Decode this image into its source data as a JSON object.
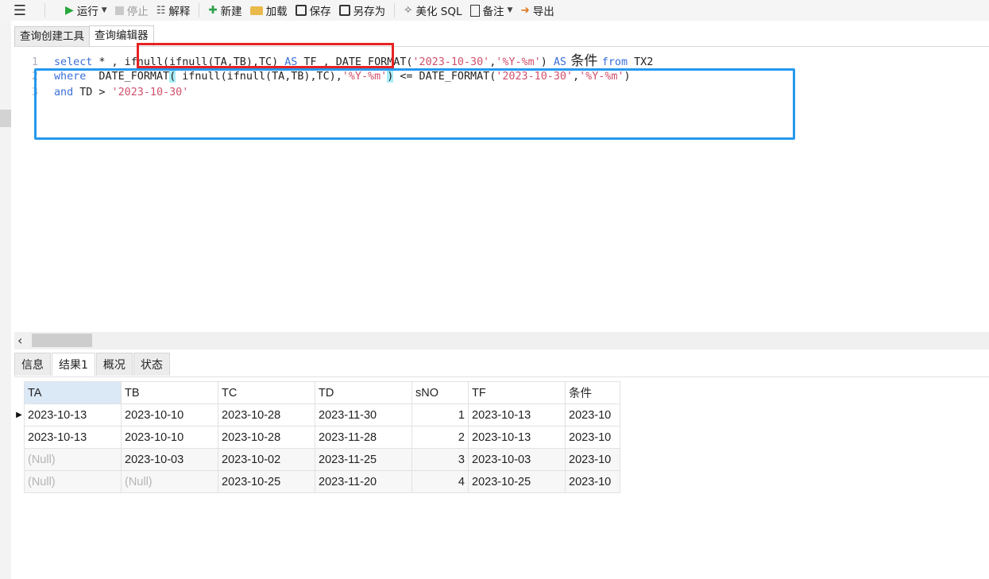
{
  "toolbar": {
    "run": "运行",
    "stop": "停止",
    "explain": "解释",
    "new": "新建",
    "load": "加载",
    "save": "保存",
    "save_as": "另存为",
    "beautify": "美化 SQL",
    "comment": "备注",
    "export": "导出"
  },
  "editor_tabs": [
    "查询创建工具",
    "查询编辑器"
  ],
  "code": {
    "line1": {
      "num": "1",
      "t1": "select",
      "t2": " * , ifnull(ifnull(TA,TB),TC) ",
      "t3": "AS",
      "t4": " TF , DATE_FORMAT(",
      "t5": "'2023-10-30'",
      "t6": ",",
      "t7": "'%Y-%m'",
      "t8": ") ",
      "t9": "AS",
      "t10": " 条件 ",
      "t11": "from",
      "t12": " TX2"
    },
    "line2": {
      "num": "2",
      "t1": "where",
      "t2": "  DATE_FORMAT",
      "t3": "(",
      "t4": " ifnull(ifnull(TA,TB),TC),",
      "t5": "'%Y-%m'",
      "t6": ")",
      "t7": " <= DATE_FORMAT(",
      "t8": "'2023-10-30'",
      "t9": ",",
      "t10": "'%Y-%m'",
      "t11": ")"
    },
    "line3": {
      "num": "3",
      "t1": "and",
      "t2": " TD > ",
      "t3": "'2023-10-30'"
    }
  },
  "result_tabs": [
    "信息",
    "结果1",
    "概况",
    "状态"
  ],
  "grid": {
    "columns": [
      "TA",
      "TB",
      "TC",
      "TD",
      "sNO",
      "TF",
      "条件"
    ],
    "rows": [
      [
        "2023-10-13",
        "2023-10-10",
        "2023-10-28",
        "2023-11-30",
        "1",
        "2023-10-13",
        "2023-10"
      ],
      [
        "2023-10-13",
        "2023-10-10",
        "2023-10-28",
        "2023-11-28",
        "2",
        "2023-10-13",
        "2023-10"
      ],
      [
        "(Null)",
        "2023-10-03",
        "2023-10-02",
        "2023-11-25",
        "3",
        "2023-10-03",
        "2023-10"
      ],
      [
        "(Null)",
        "(Null)",
        "2023-10-25",
        "2023-11-20",
        "4",
        "2023-10-25",
        "2023-10"
      ]
    ]
  },
  "colors": {
    "keyword": "#3a6fd8",
    "string": "#d0506a",
    "red_box": "#e62323",
    "blue_box": "#2599ee"
  }
}
